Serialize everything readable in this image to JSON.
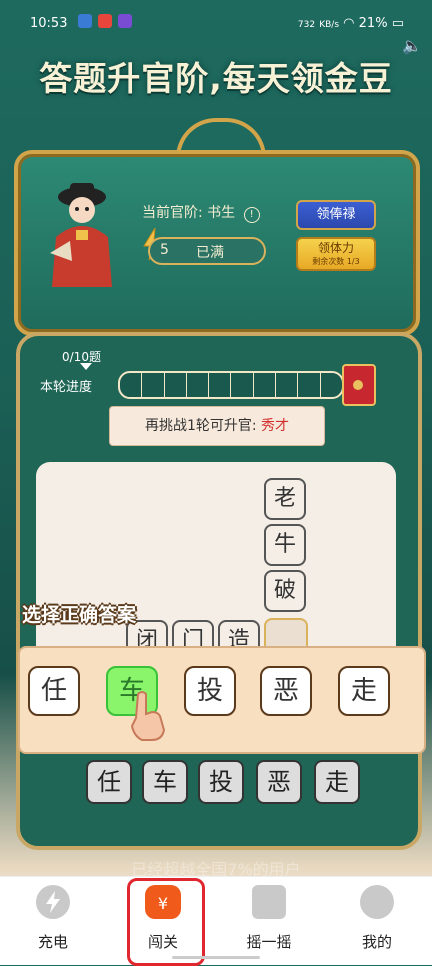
{
  "status_bar": {
    "time": "10:53",
    "battery": "21%",
    "net_speed_value": "732",
    "net_speed_unit": "KB/s"
  },
  "banner": {
    "title": "答题升官阶,每天领金豆"
  },
  "profile": {
    "rank_prefix": "当前官阶:",
    "rank_value": "书生",
    "info_icon": "!",
    "energy_value": "5",
    "energy_status": "已满",
    "salary_button": "领俸禄",
    "stamina_button": "领体力",
    "stamina_sub": "剩余次数 1/3"
  },
  "progress": {
    "count": "0/10题",
    "label": "本轮进度",
    "filled": 0,
    "total": 10
  },
  "challenge": {
    "prefix": "再挑战1轮可升官:",
    "rank": "秀才"
  },
  "idiom": {
    "vertical": [
      "老",
      "牛",
      "破"
    ],
    "horizontal": [
      "闭",
      "门",
      "造"
    ]
  },
  "guide_text": "选择正确答案",
  "choices": [
    "任",
    "车",
    "投",
    "恶",
    "走"
  ],
  "choices_active_index": 1,
  "answers": [
    "任",
    "车",
    "投",
    "恶",
    "走"
  ],
  "footer_note": "已经超越全国7%的用户",
  "nav": [
    {
      "label": "充电",
      "icon": "bolt-icon"
    },
    {
      "label": "闯关",
      "icon": "money-bag-icon"
    },
    {
      "label": "摇一摇",
      "icon": "shake-phone-icon"
    },
    {
      "label": "我的",
      "icon": "profile-icon"
    }
  ],
  "colors": {
    "accent": "#f05a1a",
    "nav_highlight": "#e0262e",
    "panel": "#1f6657"
  }
}
